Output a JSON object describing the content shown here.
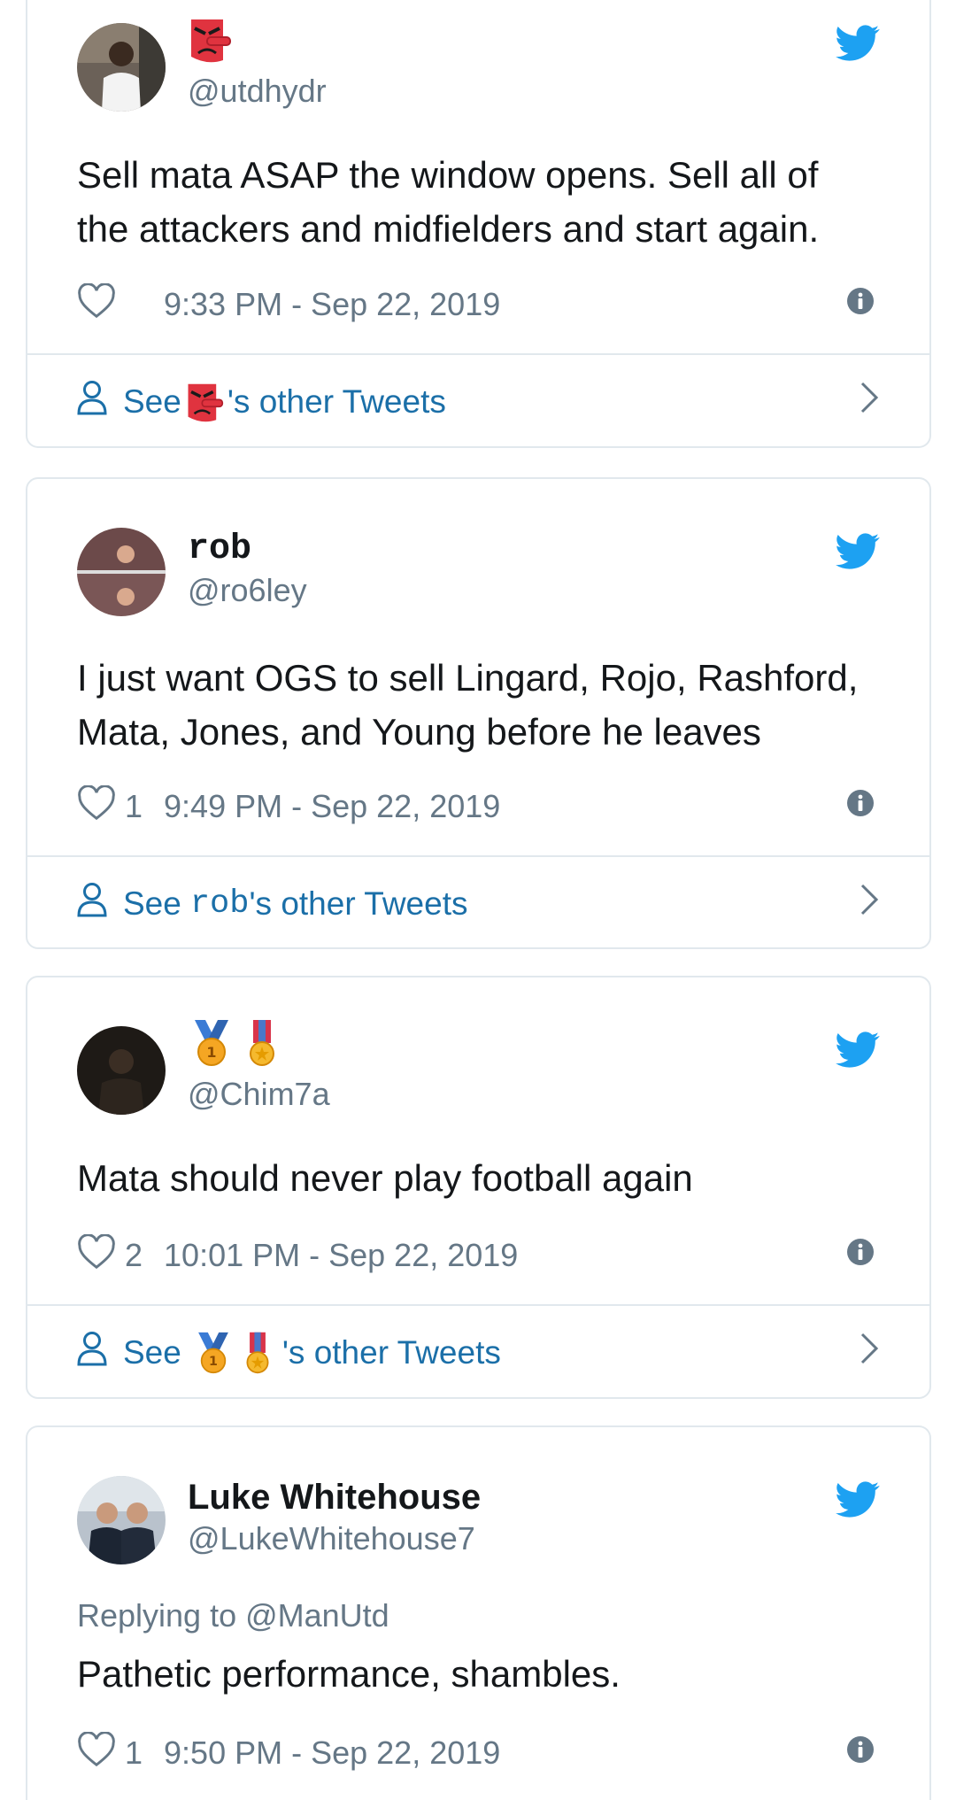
{
  "tweets": [
    {
      "name": "",
      "handle": "@utdhydr",
      "text": "Sell mata ASAP the window opens. Sell all of the attackers and midfielders and start again.",
      "likes": "",
      "time": "9:33 PM - Sep 22, 2019",
      "see_prefix": "See",
      "see_suffix": "'s other Tweets",
      "name_icons": [
        "tengu-emoji-icon"
      ]
    },
    {
      "name": "rob",
      "handle": "@ro6ley",
      "text": "I just want OGS to sell Lingard, Rojo, Rashford, Mata, Jones, and Young before he leaves",
      "likes": "1",
      "time": "9:49 PM - Sep 22, 2019",
      "see_prefix": "See",
      "see_name": "rob",
      "see_suffix": "'s other Tweets"
    },
    {
      "name": "",
      "handle": "@Chim7a",
      "text": "Mata should never play football again",
      "likes": "2",
      "time": "10:01 PM - Sep 22, 2019",
      "see_prefix": "See",
      "see_suffix": "'s other Tweets",
      "name_icons": [
        "first-place-medal-icon",
        "military-medal-icon"
      ]
    },
    {
      "name": "Luke Whitehouse",
      "handle": "@LukeWhitehouse7",
      "reply_to": "Replying to @ManUtd",
      "text": "Pathetic performance, shambles.",
      "likes": "1",
      "time": "9:50 PM - Sep 22, 2019"
    }
  ],
  "colors": {
    "twitter_blue": "#1da1f2",
    "link_blue": "#1b6fa8",
    "secondary_gray": "#657786",
    "border": "#e1e8ed"
  }
}
